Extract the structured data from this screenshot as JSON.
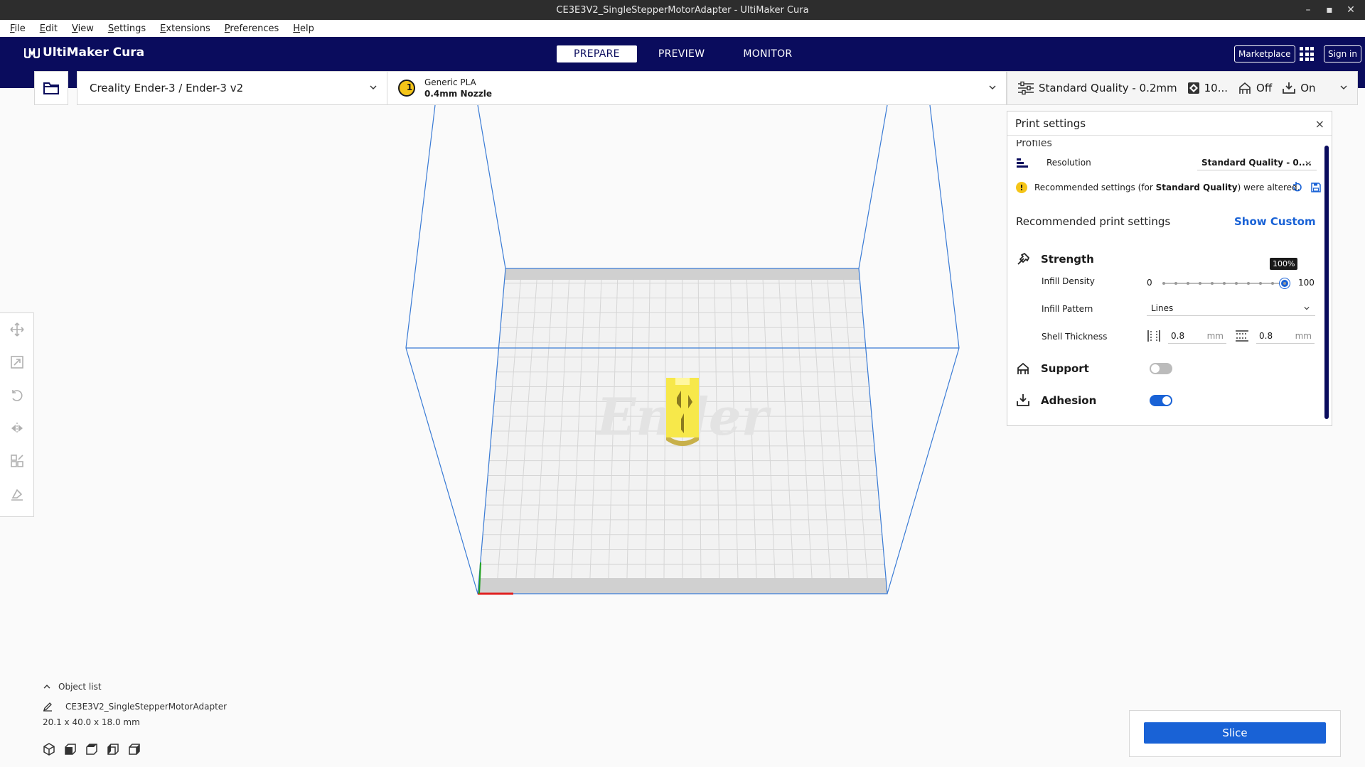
{
  "window": {
    "title": "CE3E3V2_SingleStepperMotorAdapter - UltiMaker Cura",
    "minimize": "–",
    "maximize": "▪",
    "close": "✕"
  },
  "menu": [
    {
      "label": "File",
      "key": "F",
      "rest": "ile"
    },
    {
      "label": "Edit",
      "key": "E",
      "rest": "dit"
    },
    {
      "label": "View",
      "key": "V",
      "rest": "iew"
    },
    {
      "label": "Settings",
      "key": "S",
      "rest": "ettings"
    },
    {
      "label": "Extensions",
      "key": "E",
      "rest": "xtensions"
    },
    {
      "label": "Preferences",
      "key": "P",
      "rest": "references"
    },
    {
      "label": "Help",
      "key": "H",
      "rest": "elp"
    }
  ],
  "header": {
    "logo": "UltiMaker Cura",
    "tabs": [
      {
        "label": "PREPARE",
        "active": true
      },
      {
        "label": "PREVIEW",
        "active": false
      },
      {
        "label": "MONITOR",
        "active": false
      }
    ],
    "marketplace": "Marketplace",
    "sign_in": "Sign in"
  },
  "stage": {
    "printer": "Creality Ender-3 / Ender-3 v2",
    "extruder_number": "1",
    "material": "Generic PLA",
    "nozzle": "0.4mm Nozzle",
    "quality": "Standard Quality - 0.2mm",
    "infill_short": "10...",
    "support": "Off",
    "adhesion": "On"
  },
  "viewport": {
    "watermark": "Ender",
    "bed_color": "#f2f2f2",
    "grid_color": "#d6d6d6",
    "outline_color": "#3a7bd5",
    "model_color": "#f7e84a",
    "model_shadow": "#c8b04a"
  },
  "print_settings": {
    "title": "Print settings",
    "close": "×",
    "profiles_label": "Profiles",
    "resolution_label": "Resolution",
    "resolution_value": "Standard Quality - 0....",
    "warning_icon": "!",
    "warning_prefix": "Recommended settings (for ",
    "warning_bold": "Standard Quality",
    "warning_suffix": ") were altered.",
    "recommended_title": "Recommended print settings",
    "show_custom": "Show Custom",
    "strength": "Strength",
    "infill_density_label": "Infill Density",
    "infill_min": "0",
    "infill_max": "100",
    "infill_value_label": "100%",
    "infill_fraction": 1.0,
    "infill_pattern_label": "Infill Pattern",
    "infill_pattern_value": "Lines",
    "shell_thickness_label": "Shell Thickness",
    "wall_thickness": "0.8",
    "top_bottom_thickness": "0.8",
    "unit": "mm",
    "support": "Support",
    "support_enabled": false,
    "adhesion": "Adhesion",
    "adhesion_enabled": true
  },
  "object_list": {
    "title": "Object list",
    "object_name": "CE3E3V2_SingleStepperMotorAdapter",
    "dimensions": "20.1 x 40.0 x 18.0 mm"
  },
  "slice": {
    "label": "Slice"
  },
  "colors": {
    "header": "#0a0c5d",
    "accent": "#1962d6",
    "warning": "#f5c518"
  }
}
